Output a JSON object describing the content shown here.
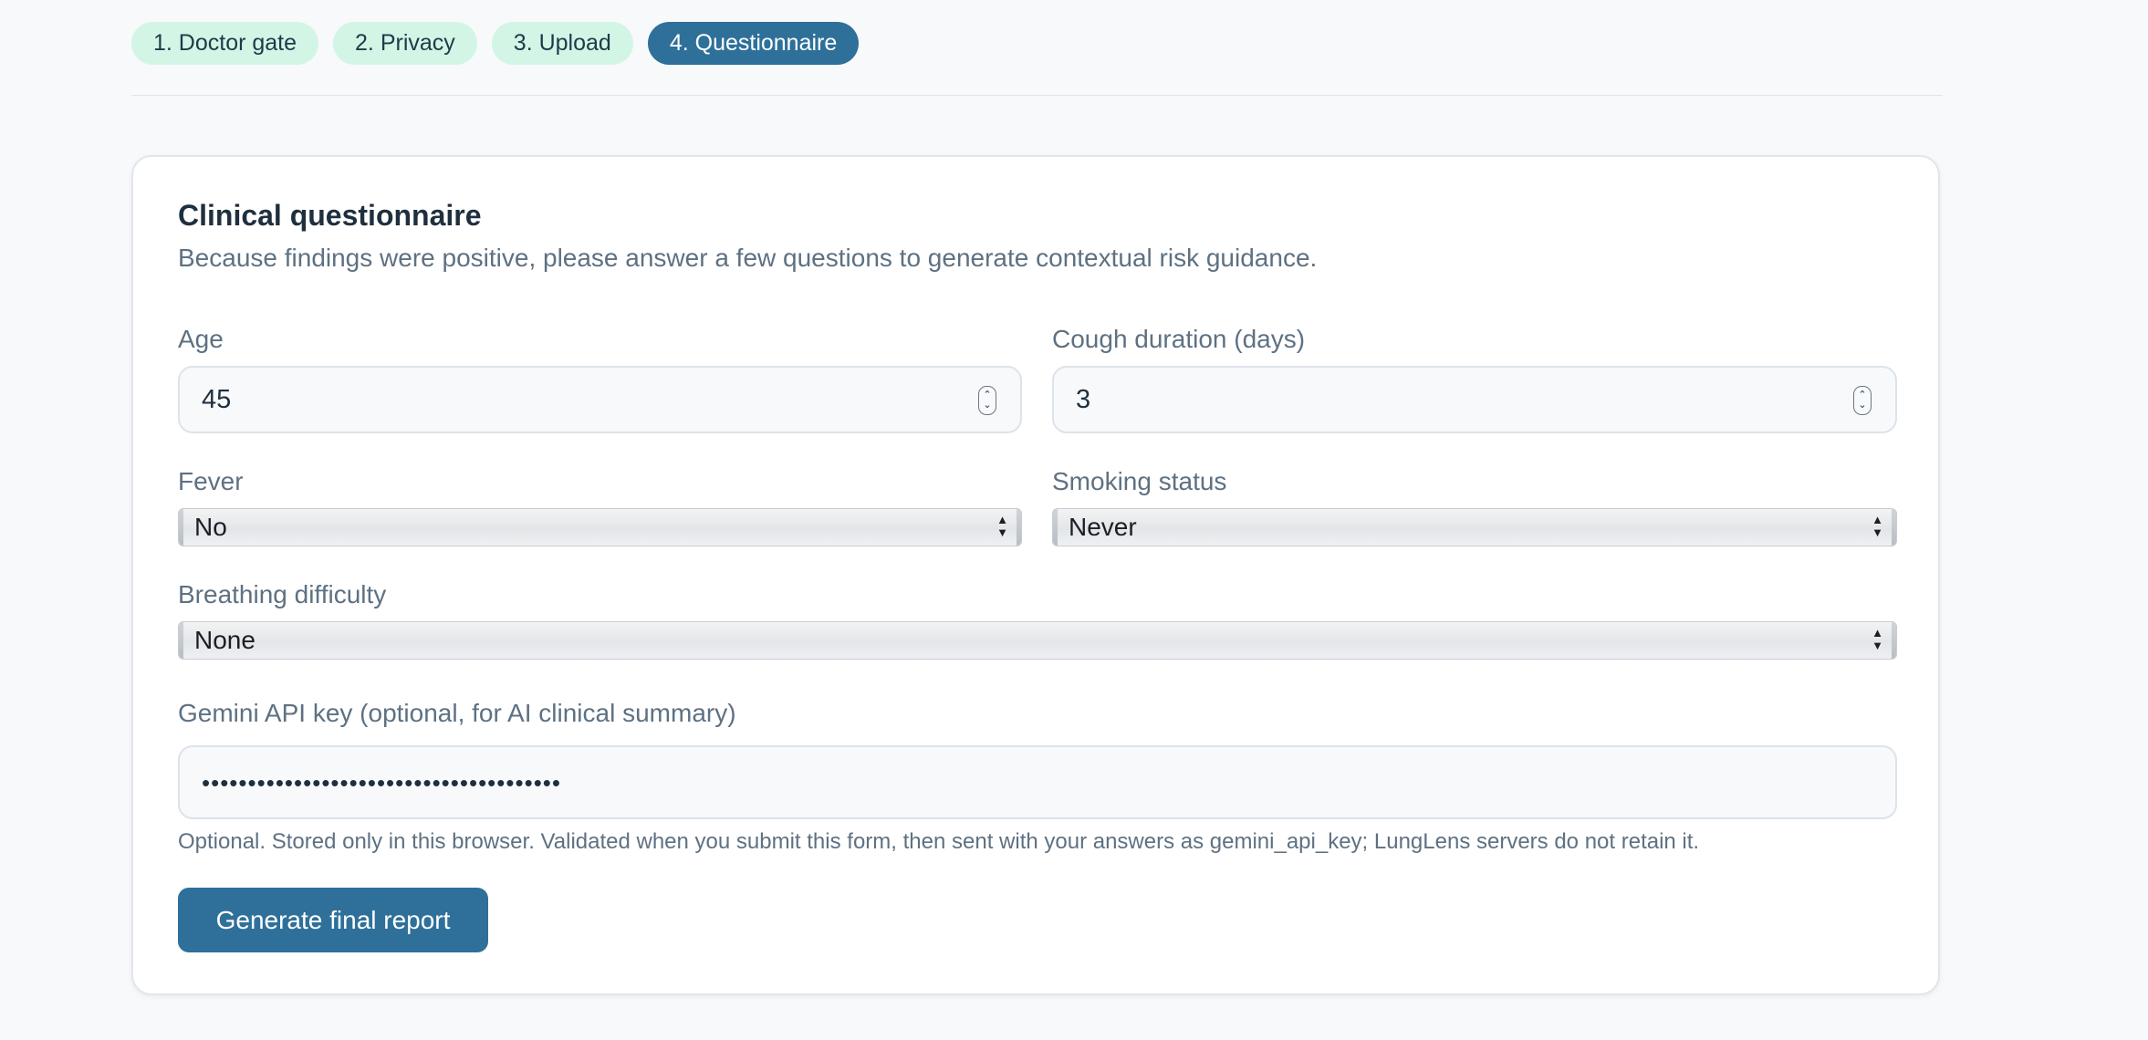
{
  "steps": [
    {
      "label": "1. Doctor gate",
      "active": false
    },
    {
      "label": "2. Privacy",
      "active": false
    },
    {
      "label": "3. Upload",
      "active": false
    },
    {
      "label": "4. Questionnaire",
      "active": true
    }
  ],
  "card": {
    "title": "Clinical questionnaire",
    "subtitle": "Because findings were positive, please answer a few questions to generate contextual risk guidance."
  },
  "fields": {
    "age": {
      "label": "Age",
      "value": "45"
    },
    "cough": {
      "label": "Cough duration (days)",
      "value": "3"
    },
    "fever": {
      "label": "Fever",
      "value": "No"
    },
    "smoking": {
      "label": "Smoking status",
      "value": "Never"
    },
    "breathing": {
      "label": "Breathing difficulty",
      "value": "None"
    },
    "gemini": {
      "label": "Gemini API key (optional, for AI clinical summary)",
      "value": "•••••••••••••••••••••••••••••••••••••••",
      "help": "Optional. Stored only in this browser. Validated when you submit this form, then sent with your answers as gemini_api_key; LungLens servers do not retain it."
    }
  },
  "submit_label": "Generate final report",
  "colors": {
    "accent": "#2e709a",
    "step_inactive_bg": "#d3f5e6",
    "page_bg": "#f7f9fb"
  },
  "icons": {
    "spinner": "up-down-stepper-icon",
    "select_arrow": "select-updown-icon"
  }
}
